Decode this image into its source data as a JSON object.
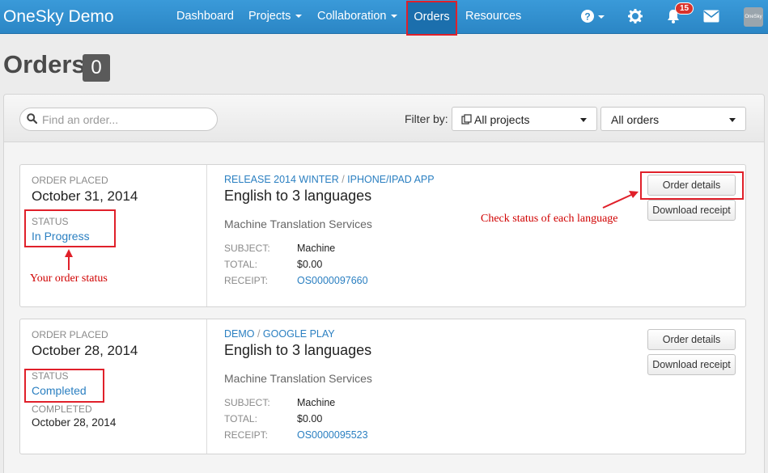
{
  "navbar": {
    "brand": "OneSky Demo",
    "items": [
      {
        "label": "Dashboard",
        "has_caret": false
      },
      {
        "label": "Projects",
        "has_caret": true
      },
      {
        "label": "Collaboration",
        "has_caret": true
      },
      {
        "label": "Orders",
        "active": true
      },
      {
        "label": "Resources",
        "has_caret": false
      }
    ],
    "icons": [
      "help-icon",
      "gear-icon",
      "bell-icon",
      "envelope-icon"
    ],
    "notification_count": "15",
    "avatar_text": "OneSky"
  },
  "page": {
    "title": "Orders",
    "count": "0"
  },
  "filters": {
    "search_placeholder": "Find an order...",
    "filter_label": "Filter by:",
    "project_select": "All projects",
    "orders_select": "All orders"
  },
  "orders": [
    {
      "placed_label": "ORDER PLACED",
      "placed_date": "October 31, 2014",
      "status_label": "STATUS",
      "status": "In Progress",
      "project": "RELEASE 2014 WINTER",
      "platform": "IPHONE/IPAD APP",
      "title": "English to 3 languages",
      "service": "Machine Translation Services",
      "subject_label": "SUBJECT:",
      "subject": "Machine",
      "total_label": "TOTAL:",
      "total": "$0.00",
      "receipt_label": "RECEIPT:",
      "receipt": "OS0000097660",
      "details_button": "Order details",
      "receipt_button": "Download receipt"
    },
    {
      "placed_label": "ORDER PLACED",
      "placed_date": "October 28, 2014",
      "status_label": "STATUS",
      "status": "Completed",
      "completed_label": "COMPLETED",
      "completed_date": "October 28, 2014",
      "project": "DEMO",
      "platform": "GOOGLE PLAY",
      "title": "English to 3 languages",
      "service": "Machine Translation Services",
      "subject_label": "SUBJECT:",
      "subject": "Machine",
      "total_label": "TOTAL:",
      "total": "$0.00",
      "receipt_label": "RECEIPT:",
      "receipt": "OS0000095523",
      "details_button": "Order details",
      "receipt_button": "Download receipt"
    }
  ],
  "annotations": {
    "status_note": "Your order status",
    "details_note": "Check status of each language",
    "color": "#e0202a"
  },
  "colors": {
    "navbar": "#2b86c5",
    "link": "#2a7fc1",
    "badge": "#d9322b"
  }
}
